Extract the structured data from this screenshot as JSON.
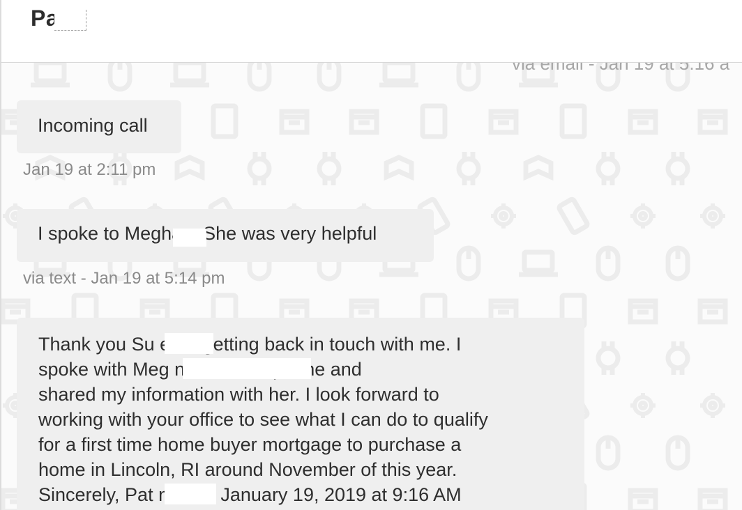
{
  "header": {
    "contact_name": "Pa"
  },
  "thread": {
    "top_meta_partial": "via email - Jan 19 at 5:16 a",
    "messages": [
      {
        "type": "call",
        "text": "Incoming call",
        "meta": "Jan 19 at 2:11 pm"
      },
      {
        "type": "text",
        "text": "I spoke to Meghan. She was very helpful",
        "meta": "via text - Jan 19 at 5:14 pm"
      },
      {
        "type": "email",
        "lines": [
          "Thank you Su        e for getting back in touch with me. I",
          "spoke with Meg                       ns over the phone and",
          "shared my information with her. I look forward to",
          "working with your office to see what I can do to qualify",
          "for a first time home buyer mortgage to purchase a",
          "home in Lincoln, RI around November of this year.",
          "Sincerely, Pat            n  > On January 19, 2019 at 9:16 AM"
        ]
      }
    ]
  },
  "colors": {
    "bubble": "#efefef",
    "background": "#fbfbfb",
    "meta_text": "#8a8a8a",
    "pattern_icon": "#ececec"
  }
}
